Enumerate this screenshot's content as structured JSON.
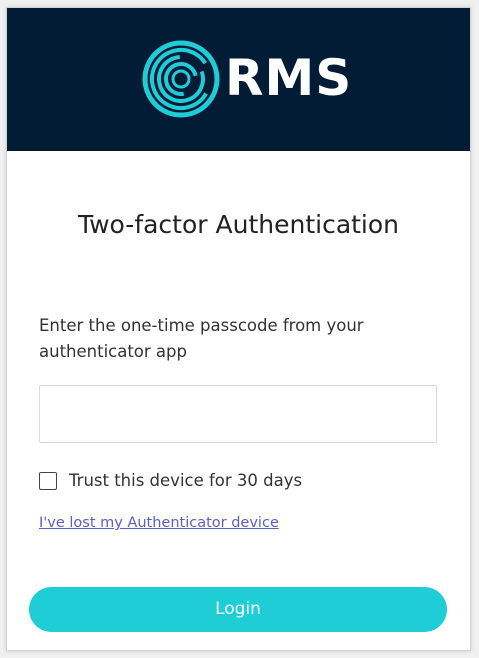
{
  "brand": {
    "name": "RMS",
    "logo_icon": "rms-ring-logo-icon",
    "header_color": "#021c36",
    "accent_color": "#1ecdd6"
  },
  "form": {
    "title": "Two-factor Authentication",
    "instructions": "Enter the one-time passcode from your authenticator app",
    "passcode_value": "",
    "trust_label": "Trust this device for 30 days",
    "trust_checked": false,
    "lost_device_link": "I've lost my Authenticator device",
    "login_label": "Login"
  }
}
